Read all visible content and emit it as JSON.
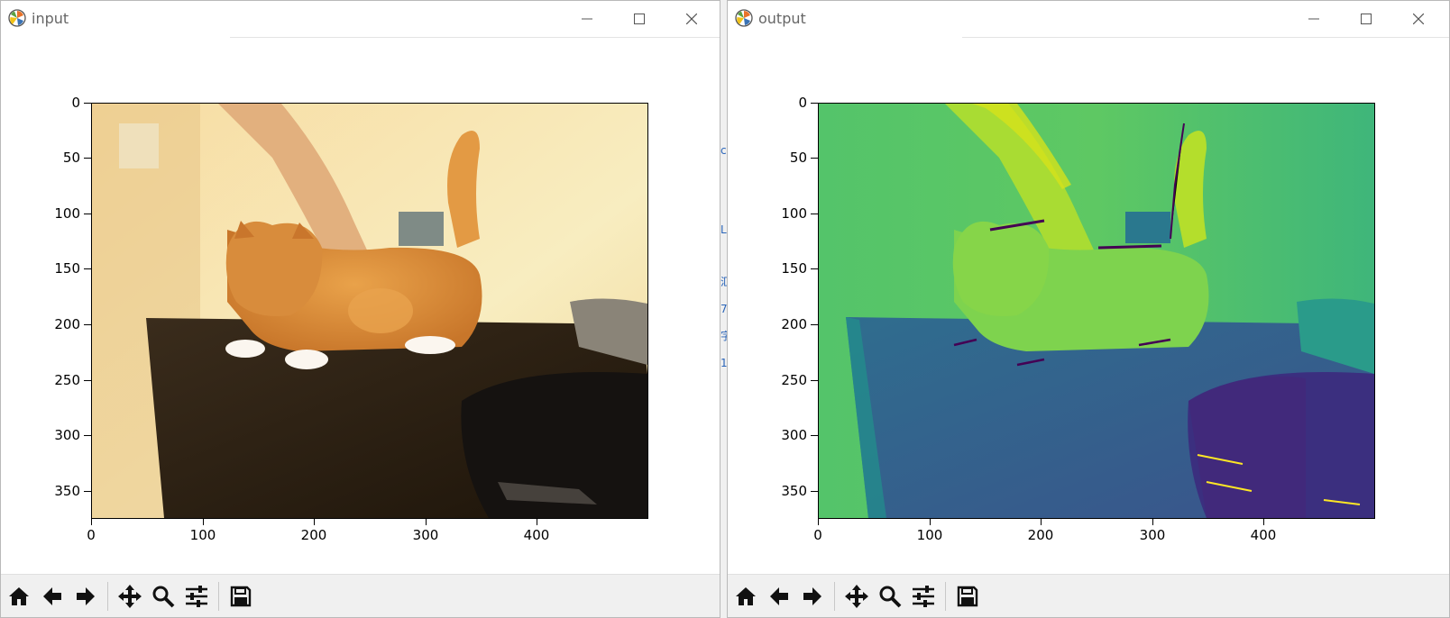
{
  "windows": [
    {
      "title": "input",
      "colors": {
        "accent": "#1f77b4"
      },
      "axes": {
        "y_ticks": [
          "0",
          "50",
          "100",
          "150",
          "200",
          "250",
          "300",
          "350"
        ],
        "x_ticks": [
          "0",
          "100",
          "200",
          "300",
          "400"
        ]
      },
      "toolbar": [
        "home-icon",
        "back-icon",
        "forward-icon",
        "pan-icon",
        "zoom-icon",
        "configure-icon",
        "save-icon"
      ]
    },
    {
      "title": "output",
      "colors": {
        "accent": "#440154"
      },
      "axes": {
        "y_ticks": [
          "0",
          "50",
          "100",
          "150",
          "200",
          "250",
          "300",
          "350"
        ],
        "x_ticks": [
          "0",
          "100",
          "200",
          "300",
          "400"
        ]
      },
      "toolbar": [
        "home-icon",
        "back-icon",
        "forward-icon",
        "pan-icon",
        "zoom-icon",
        "configure-icon",
        "save-icon"
      ]
    }
  ],
  "background_fragments": [
    "c",
    "L",
    "汇",
    "7",
    "字",
    "1"
  ]
}
